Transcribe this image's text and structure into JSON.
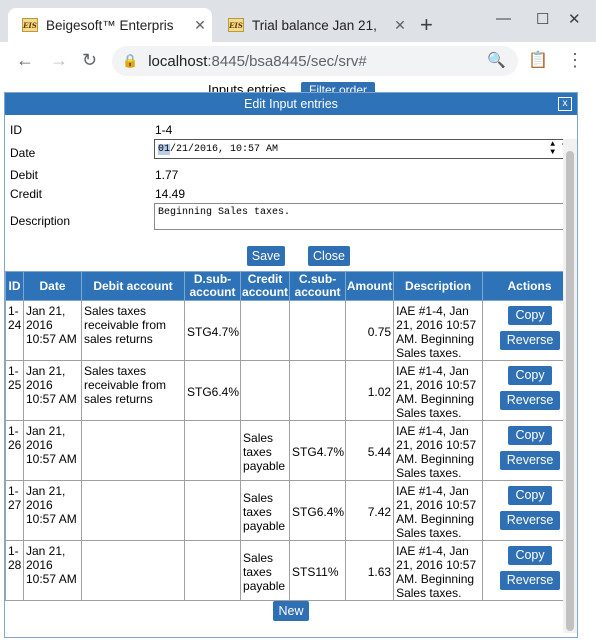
{
  "browser": {
    "tabs": [
      {
        "title": "Beigesoft™ Enterpris",
        "favicon": "EIS"
      },
      {
        "title": "Trial balance Jan 21,",
        "favicon": "EIS"
      }
    ],
    "url_host": "localhost",
    "url_rest": ":8445/bsa8445/sec/srv#"
  },
  "background": {
    "header": "Inputs entries",
    "filter_button": "Filter order"
  },
  "dialog": {
    "title": "Edit Input entries",
    "close_label": "x",
    "fields": {
      "id_label": "ID",
      "id_value": "1-4",
      "date_label": "Date",
      "date_value_hl": "01",
      "date_value_rest": "/21/2016, 10:57 AM",
      "debit_label": "Debit",
      "debit_value": "1.77",
      "credit_label": "Credit",
      "credit_value": "14.49",
      "description_label": "Description",
      "description_value": "Beginning Sales taxes."
    },
    "save_label": "Save",
    "close_button_label": "Close",
    "new_label": "New"
  },
  "table": {
    "headers": [
      "ID",
      "Date",
      "Debit account",
      "D.sub-account",
      "Credit account",
      "C.sub-account",
      "Amount",
      "Description",
      "Actions"
    ],
    "copy_label": "Copy",
    "reverse_label": "Reverse",
    "rows": [
      {
        "id": "1-24",
        "date": "Jan 21, 2016 10:57 AM",
        "debit_account": "Sales taxes receivable from sales returns",
        "d_sub": "STG4.7%",
        "credit_account": "",
        "c_sub": "",
        "amount": "0.75",
        "description": "IAE #1-4, Jan 21, 2016 10:57 AM. Beginning Sales taxes."
      },
      {
        "id": "1-25",
        "date": "Jan 21, 2016 10:57 AM",
        "debit_account": "Sales taxes receivable from sales returns",
        "d_sub": "STG6.4%",
        "credit_account": "",
        "c_sub": "",
        "amount": "1.02",
        "description": "IAE #1-4, Jan 21, 2016 10:57 AM. Beginning Sales taxes."
      },
      {
        "id": "1-26",
        "date": "Jan 21, 2016 10:57 AM",
        "debit_account": "",
        "d_sub": "",
        "credit_account": "Sales taxes payable",
        "c_sub": "STG4.7%",
        "amount": "5.44",
        "description": "IAE #1-4, Jan 21, 2016 10:57 AM. Beginning Sales taxes."
      },
      {
        "id": "1-27",
        "date": "Jan 21, 2016 10:57 AM",
        "debit_account": "",
        "d_sub": "",
        "credit_account": "Sales taxes payable",
        "c_sub": "STG6.4%",
        "amount": "7.42",
        "description": "IAE #1-4, Jan 21, 2016 10:57 AM. Beginning Sales taxes."
      },
      {
        "id": "1-28",
        "date": "Jan 21, 2016 10:57 AM",
        "debit_account": "",
        "d_sub": "",
        "credit_account": "Sales taxes payable",
        "c_sub": "STS11%",
        "amount": "1.63",
        "description": "IAE #1-4, Jan 21, 2016 10:57 AM. Beginning Sales taxes."
      }
    ]
  },
  "colors": {
    "accent": "#2e73b8"
  }
}
